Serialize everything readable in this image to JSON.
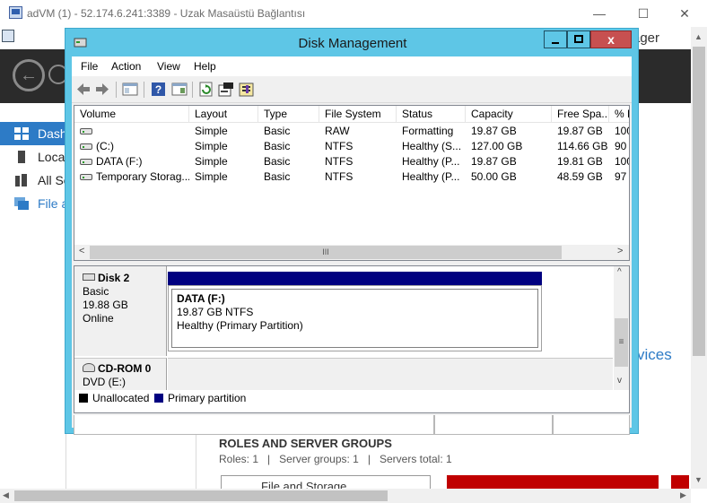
{
  "rdp": {
    "title": "adVM (1) - 52.174.6.241:3389 - Uzak Masaüstü Bağlantısı",
    "minimize": "—",
    "maximize": "☐",
    "close": "✕"
  },
  "server_manager": {
    "title_fragment": "ager",
    "nav": [
      "Dash",
      "Local",
      "All Se",
      "File a"
    ],
    "services_fragment": "vices",
    "roles_title": "ROLES AND SERVER GROUPS",
    "roles_line": "Roles: 1   |   Server groups: 1   |   Servers total: 1",
    "tile_label": "File and Storage"
  },
  "disk_management": {
    "title": "Disk Management",
    "close_label": "x",
    "menu": [
      "File",
      "Action",
      "View",
      "Help"
    ],
    "columns": [
      "Volume",
      "Layout",
      "Type",
      "File System",
      "Status",
      "Capacity",
      "Free Spa...",
      "% F"
    ],
    "rows": [
      [
        "",
        "Simple",
        "Basic",
        "RAW",
        "Formatting",
        "19.87 GB",
        "19.87 GB",
        "100"
      ],
      [
        "(C:)",
        "Simple",
        "Basic",
        "NTFS",
        "Healthy (S...",
        "127.00 GB",
        "114.66 GB",
        "90"
      ],
      [
        "DATA (F:)",
        "Simple",
        "Basic",
        "NTFS",
        "Healthy (P...",
        "19.87 GB",
        "19.81 GB",
        "100"
      ],
      [
        "Temporary Storag...",
        "Simple",
        "Basic",
        "NTFS",
        "Healthy (P...",
        "50.00 GB",
        "48.59 GB",
        "97"
      ]
    ],
    "disk2": {
      "name": "Disk 2",
      "type": "Basic",
      "size": "19.88 GB",
      "state": "Online",
      "partition_name": "DATA  (F:)",
      "partition_size": "19.87 GB NTFS",
      "partition_status": "Healthy (Primary Partition)"
    },
    "cdrom": {
      "name": "CD-ROM 0",
      "drive": "DVD (E:)"
    },
    "legend": {
      "unallocated": "Unallocated",
      "primary": "Primary partition",
      "unallocated_color": "#000000",
      "primary_color": "#000080"
    }
  },
  "colors": {
    "window_frame": "#5ec6e6",
    "close_button": "#c75050",
    "nav_active": "#2d7bc6",
    "sm_header": "#2b2b2b",
    "tile_red": "#c00000"
  }
}
